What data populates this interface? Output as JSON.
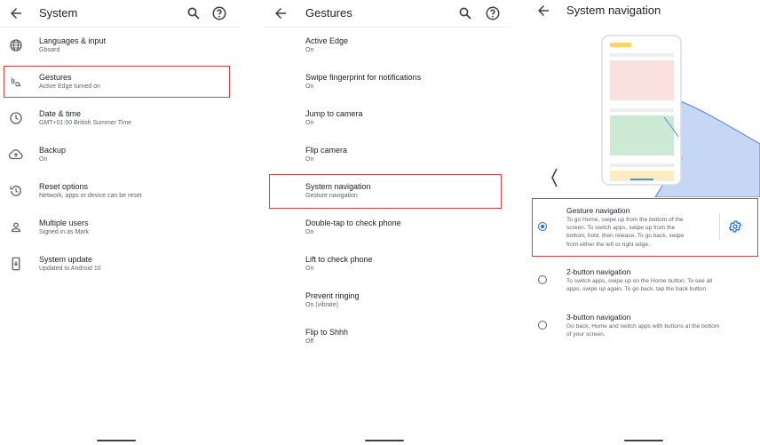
{
  "system": {
    "title": "System",
    "items": [
      {
        "icon": "globe-icon",
        "title": "Languages & input",
        "subtitle": "Gboard"
      },
      {
        "icon": "gestures-icon",
        "title": "Gestures",
        "subtitle": "Active Edge turned on"
      },
      {
        "icon": "clock-icon",
        "title": "Date & time",
        "subtitle": "GMT+01:00 British Summer Time"
      },
      {
        "icon": "cloud-upload-icon",
        "title": "Backup",
        "subtitle": "On"
      },
      {
        "icon": "history-icon",
        "title": "Reset options",
        "subtitle": "Network, apps or device can be reset"
      },
      {
        "icon": "person-icon",
        "title": "Multiple users",
        "subtitle": "Signed in as Mark"
      },
      {
        "icon": "system-update-icon",
        "title": "System update",
        "subtitle": "Updated to Android 10"
      }
    ]
  },
  "gestures": {
    "title": "Gestures",
    "items": [
      {
        "title": "Active Edge",
        "subtitle": "On"
      },
      {
        "title": "Swipe fingerprint for notifications",
        "subtitle": "On"
      },
      {
        "title": "Jump to camera",
        "subtitle": "On"
      },
      {
        "title": "Flip camera",
        "subtitle": "On"
      },
      {
        "title": "System navigation",
        "subtitle": "Gesture navigation"
      },
      {
        "title": "Double-tap to check phone",
        "subtitle": "On"
      },
      {
        "title": "Lift to check phone",
        "subtitle": "On"
      },
      {
        "title": "Prevent ringing",
        "subtitle": "On (vibrate)"
      },
      {
        "title": "Flip to Shhh",
        "subtitle": "Off"
      }
    ]
  },
  "navigation": {
    "title": "System navigation",
    "options": [
      {
        "title": "Gesture navigation",
        "selected": true,
        "lines": [
          "To go Home, swipe up from the bottom of the",
          "screen. To switch apps, swipe up from the",
          "bottom, hold, then release. To go back, swipe",
          "from either the left or right edge."
        ]
      },
      {
        "title": "2-button navigation",
        "selected": false,
        "lines": [
          "To switch apps, swipe up on the Home button. To see all",
          "apps, swipe up again. To go back, tap the back button."
        ]
      },
      {
        "title": "3-button navigation",
        "selected": false,
        "lines": [
          "Go back, Home and switch apps with buttons at the bottom",
          "of your screen."
        ]
      }
    ]
  },
  "colors": {
    "accent": "#1a73e8",
    "highlight": "#d64545"
  }
}
